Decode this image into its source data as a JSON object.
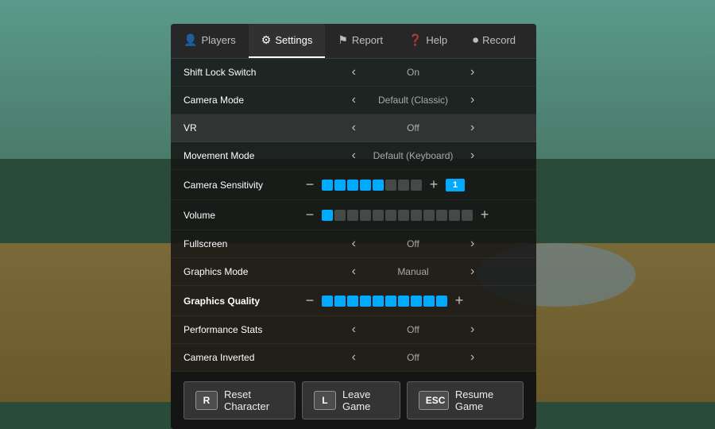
{
  "background": {
    "color": "#3a6a5a"
  },
  "tabs": [
    {
      "id": "players",
      "label": "Players",
      "icon": "👤",
      "active": false
    },
    {
      "id": "settings",
      "label": "Settings",
      "icon": "⚙",
      "active": true
    },
    {
      "id": "report",
      "label": "Report",
      "icon": "⚑",
      "active": false
    },
    {
      "id": "help",
      "label": "Help",
      "icon": "?",
      "active": false
    },
    {
      "id": "record",
      "label": "Record",
      "icon": "⏺",
      "active": false
    }
  ],
  "settings": [
    {
      "id": "shift-lock",
      "label": "Shift Lock Switch",
      "type": "toggle",
      "value": "On",
      "bold": false
    },
    {
      "id": "camera-mode",
      "label": "Camera Mode",
      "type": "toggle",
      "value": "Default (Classic)",
      "bold": false
    },
    {
      "id": "vr",
      "label": "VR",
      "type": "toggle",
      "value": "Off",
      "bold": false,
      "highlighted": true
    },
    {
      "id": "movement-mode",
      "label": "Movement Mode",
      "type": "toggle",
      "value": "Default (Keyboard)",
      "bold": false
    },
    {
      "id": "camera-sensitivity",
      "label": "Camera Sensitivity",
      "type": "slider",
      "filledBars": 5,
      "totalBars": 8,
      "numValue": "1",
      "bold": false
    },
    {
      "id": "volume",
      "label": "Volume",
      "type": "slider-vol",
      "filledBars": 1,
      "totalBars": 12,
      "bold": false
    },
    {
      "id": "fullscreen",
      "label": "Fullscreen",
      "type": "toggle",
      "value": "Off",
      "bold": false
    },
    {
      "id": "graphics-mode",
      "label": "Graphics Mode",
      "type": "toggle",
      "value": "Manual",
      "bold": false
    },
    {
      "id": "graphics-quality",
      "label": "Graphics Quality",
      "type": "slider-gfx",
      "filledBars": 10,
      "totalBars": 10,
      "bold": true
    },
    {
      "id": "performance-stats",
      "label": "Performance Stats",
      "type": "toggle",
      "value": "Off",
      "bold": false
    },
    {
      "id": "camera-inverted",
      "label": "Camera Inverted",
      "type": "toggle",
      "value": "Off",
      "bold": false
    }
  ],
  "buttons": [
    {
      "id": "reset",
      "key": "R",
      "label": "Reset Character"
    },
    {
      "id": "leave",
      "key": "L",
      "label": "Leave Game"
    },
    {
      "id": "resume",
      "key": "ESC",
      "label": "Resume Game"
    }
  ]
}
